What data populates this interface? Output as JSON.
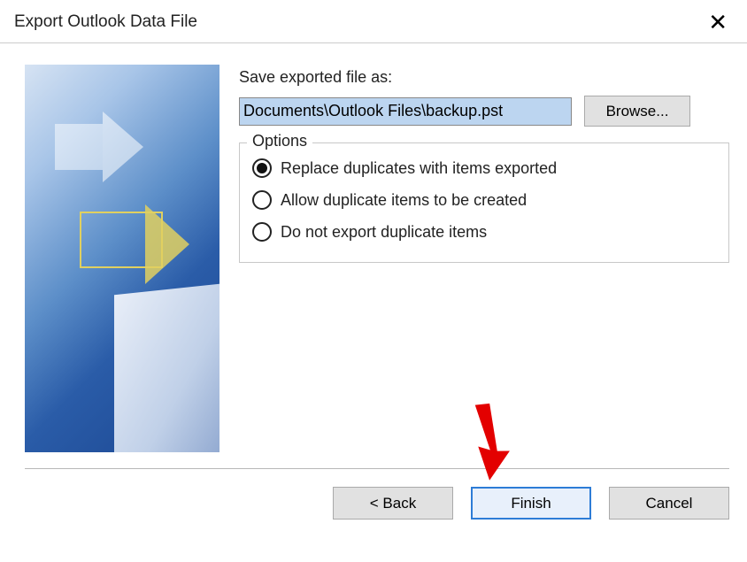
{
  "dialog": {
    "title": "Export Outlook Data File"
  },
  "form": {
    "saveLabel": "Save exported file as:",
    "pathValue": "Documents\\Outlook Files\\backup.pst",
    "browseLabel": "Browse...",
    "optionsLegend": "Options",
    "radios": [
      {
        "label": "Replace duplicates with items exported",
        "selected": true
      },
      {
        "label": "Allow duplicate items to be created",
        "selected": false
      },
      {
        "label": "Do not export duplicate items",
        "selected": false
      }
    ]
  },
  "buttons": {
    "back": "< Back",
    "finish": "Finish",
    "cancel": "Cancel"
  }
}
